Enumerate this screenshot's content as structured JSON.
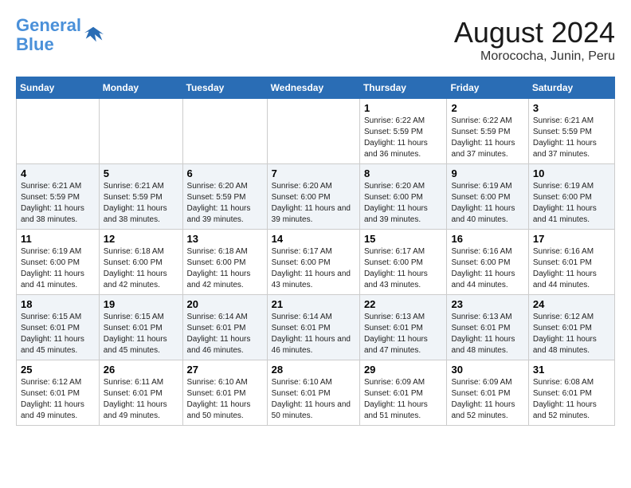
{
  "logo": {
    "line1": "General",
    "line2": "Blue"
  },
  "title": "August 2024",
  "subtitle": "Morococha, Junin, Peru",
  "weekdays": [
    "Sunday",
    "Monday",
    "Tuesday",
    "Wednesday",
    "Thursday",
    "Friday",
    "Saturday"
  ],
  "weeks": [
    [
      {
        "day": "",
        "sunrise": "",
        "sunset": "",
        "daylight": ""
      },
      {
        "day": "",
        "sunrise": "",
        "sunset": "",
        "daylight": ""
      },
      {
        "day": "",
        "sunrise": "",
        "sunset": "",
        "daylight": ""
      },
      {
        "day": "",
        "sunrise": "",
        "sunset": "",
        "daylight": ""
      },
      {
        "day": "1",
        "sunrise": "6:22 AM",
        "sunset": "5:59 PM",
        "daylight": "11 hours and 36 minutes."
      },
      {
        "day": "2",
        "sunrise": "6:22 AM",
        "sunset": "5:59 PM",
        "daylight": "11 hours and 37 minutes."
      },
      {
        "day": "3",
        "sunrise": "6:21 AM",
        "sunset": "5:59 PM",
        "daylight": "11 hours and 37 minutes."
      }
    ],
    [
      {
        "day": "4",
        "sunrise": "6:21 AM",
        "sunset": "5:59 PM",
        "daylight": "11 hours and 38 minutes."
      },
      {
        "day": "5",
        "sunrise": "6:21 AM",
        "sunset": "5:59 PM",
        "daylight": "11 hours and 38 minutes."
      },
      {
        "day": "6",
        "sunrise": "6:20 AM",
        "sunset": "5:59 PM",
        "daylight": "11 hours and 39 minutes."
      },
      {
        "day": "7",
        "sunrise": "6:20 AM",
        "sunset": "6:00 PM",
        "daylight": "11 hours and 39 minutes."
      },
      {
        "day": "8",
        "sunrise": "6:20 AM",
        "sunset": "6:00 PM",
        "daylight": "11 hours and 39 minutes."
      },
      {
        "day": "9",
        "sunrise": "6:19 AM",
        "sunset": "6:00 PM",
        "daylight": "11 hours and 40 minutes."
      },
      {
        "day": "10",
        "sunrise": "6:19 AM",
        "sunset": "6:00 PM",
        "daylight": "11 hours and 41 minutes."
      }
    ],
    [
      {
        "day": "11",
        "sunrise": "6:19 AM",
        "sunset": "6:00 PM",
        "daylight": "11 hours and 41 minutes."
      },
      {
        "day": "12",
        "sunrise": "6:18 AM",
        "sunset": "6:00 PM",
        "daylight": "11 hours and 42 minutes."
      },
      {
        "day": "13",
        "sunrise": "6:18 AM",
        "sunset": "6:00 PM",
        "daylight": "11 hours and 42 minutes."
      },
      {
        "day": "14",
        "sunrise": "6:17 AM",
        "sunset": "6:00 PM",
        "daylight": "11 hours and 43 minutes."
      },
      {
        "day": "15",
        "sunrise": "6:17 AM",
        "sunset": "6:00 PM",
        "daylight": "11 hours and 43 minutes."
      },
      {
        "day": "16",
        "sunrise": "6:16 AM",
        "sunset": "6:00 PM",
        "daylight": "11 hours and 44 minutes."
      },
      {
        "day": "17",
        "sunrise": "6:16 AM",
        "sunset": "6:01 PM",
        "daylight": "11 hours and 44 minutes."
      }
    ],
    [
      {
        "day": "18",
        "sunrise": "6:15 AM",
        "sunset": "6:01 PM",
        "daylight": "11 hours and 45 minutes."
      },
      {
        "day": "19",
        "sunrise": "6:15 AM",
        "sunset": "6:01 PM",
        "daylight": "11 hours and 45 minutes."
      },
      {
        "day": "20",
        "sunrise": "6:14 AM",
        "sunset": "6:01 PM",
        "daylight": "11 hours and 46 minutes."
      },
      {
        "day": "21",
        "sunrise": "6:14 AM",
        "sunset": "6:01 PM",
        "daylight": "11 hours and 46 minutes."
      },
      {
        "day": "22",
        "sunrise": "6:13 AM",
        "sunset": "6:01 PM",
        "daylight": "11 hours and 47 minutes."
      },
      {
        "day": "23",
        "sunrise": "6:13 AM",
        "sunset": "6:01 PM",
        "daylight": "11 hours and 48 minutes."
      },
      {
        "day": "24",
        "sunrise": "6:12 AM",
        "sunset": "6:01 PM",
        "daylight": "11 hours and 48 minutes."
      }
    ],
    [
      {
        "day": "25",
        "sunrise": "6:12 AM",
        "sunset": "6:01 PM",
        "daylight": "11 hours and 49 minutes."
      },
      {
        "day": "26",
        "sunrise": "6:11 AM",
        "sunset": "6:01 PM",
        "daylight": "11 hours and 49 minutes."
      },
      {
        "day": "27",
        "sunrise": "6:10 AM",
        "sunset": "6:01 PM",
        "daylight": "11 hours and 50 minutes."
      },
      {
        "day": "28",
        "sunrise": "6:10 AM",
        "sunset": "6:01 PM",
        "daylight": "11 hours and 50 minutes."
      },
      {
        "day": "29",
        "sunrise": "6:09 AM",
        "sunset": "6:01 PM",
        "daylight": "11 hours and 51 minutes."
      },
      {
        "day": "30",
        "sunrise": "6:09 AM",
        "sunset": "6:01 PM",
        "daylight": "11 hours and 52 minutes."
      },
      {
        "day": "31",
        "sunrise": "6:08 AM",
        "sunset": "6:01 PM",
        "daylight": "11 hours and 52 minutes."
      }
    ]
  ],
  "labels": {
    "sunrise": "Sunrise:",
    "sunset": "Sunset:",
    "daylight": "Daylight:"
  }
}
